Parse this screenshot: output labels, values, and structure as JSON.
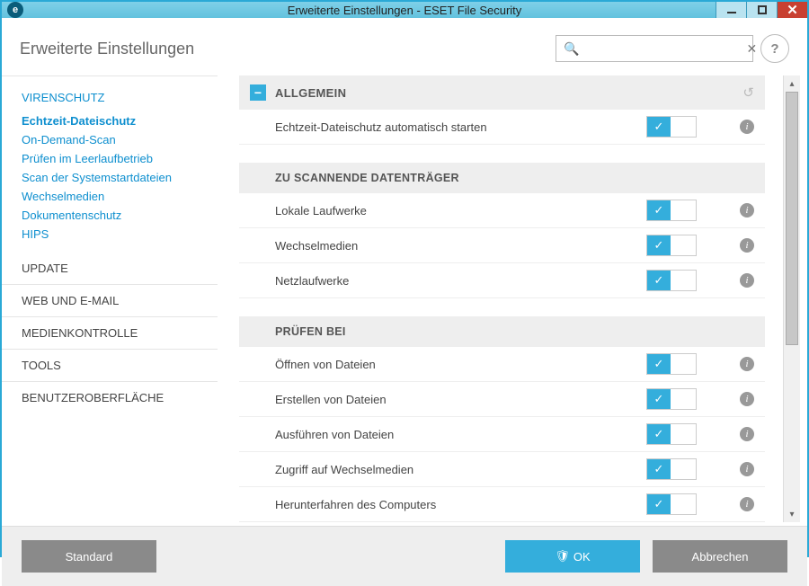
{
  "window": {
    "title": "Erweiterte Einstellungen - ESET File Security",
    "app_icon_letter": "e"
  },
  "page_title": "Erweiterte Einstellungen",
  "search": {
    "placeholder": "",
    "value": ""
  },
  "help_label": "?",
  "sidebar": {
    "categories": {
      "virenschutz": {
        "label": "VIRENSCHUTZ",
        "items": [
          "Echtzeit-Dateischutz",
          "On-Demand-Scan",
          "Prüfen im Leerlaufbetrieb",
          "Scan der Systemstartdateien",
          "Wechselmedien",
          "Dokumentenschutz",
          "HIPS"
        ],
        "active_index": 0
      },
      "others": [
        "UPDATE",
        "WEB UND E-MAIL",
        "MEDIENKONTROLLE",
        "TOOLS",
        "BENUTZEROBERFLÄCHE"
      ]
    }
  },
  "settings": {
    "group1": {
      "title": "ALLGEMEIN",
      "collapse_glyph": "−"
    },
    "rows1": [
      {
        "label": "Echtzeit-Dateischutz automatisch starten",
        "on": true
      }
    ],
    "group2": {
      "title": "ZU SCANNENDE DATENTRÄGER"
    },
    "rows2": [
      {
        "label": "Lokale Laufwerke",
        "on": true
      },
      {
        "label": "Wechselmedien",
        "on": true
      },
      {
        "label": "Netzlaufwerke",
        "on": true
      }
    ],
    "group3": {
      "title": "PRÜFEN BEI"
    },
    "rows3": [
      {
        "label": "Öffnen von Dateien",
        "on": true
      },
      {
        "label": "Erstellen von Dateien",
        "on": true
      },
      {
        "label": "Ausführen von Dateien",
        "on": true
      },
      {
        "label": "Zugriff auf Wechselmedien",
        "on": true
      },
      {
        "label": "Herunterfahren des Computers",
        "on": true
      }
    ]
  },
  "footer": {
    "default": "Standard",
    "ok": "OK",
    "cancel": "Abbrechen"
  },
  "icons": {
    "check": "✓",
    "info": "i",
    "reset": "↺",
    "shield": "🛡",
    "search": "🔍",
    "clear": "✕",
    "up": "▴",
    "down": "▾"
  }
}
